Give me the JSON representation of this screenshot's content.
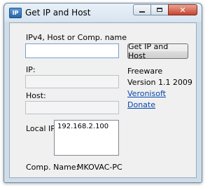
{
  "window": {
    "title": "Get IP and Host",
    "icon": "IP"
  },
  "form": {
    "host_label": "IPv4, Host or Comp. name",
    "host_value": "",
    "get_button": "Get IP and Host",
    "ip_label": "IP:",
    "ip_value": "",
    "host_result_label": "Host:",
    "host_result_value": "",
    "local_ip_label": "Local IP:",
    "local_ip_value": "192.168.2.100",
    "comp_name_label": "Comp. Name:",
    "comp_name_value": "MKOVAC-PC"
  },
  "info": {
    "license": "Freeware",
    "version": "Version 1.1 2009",
    "author_link": "Veronisoft",
    "donate_link": "Donate"
  }
}
